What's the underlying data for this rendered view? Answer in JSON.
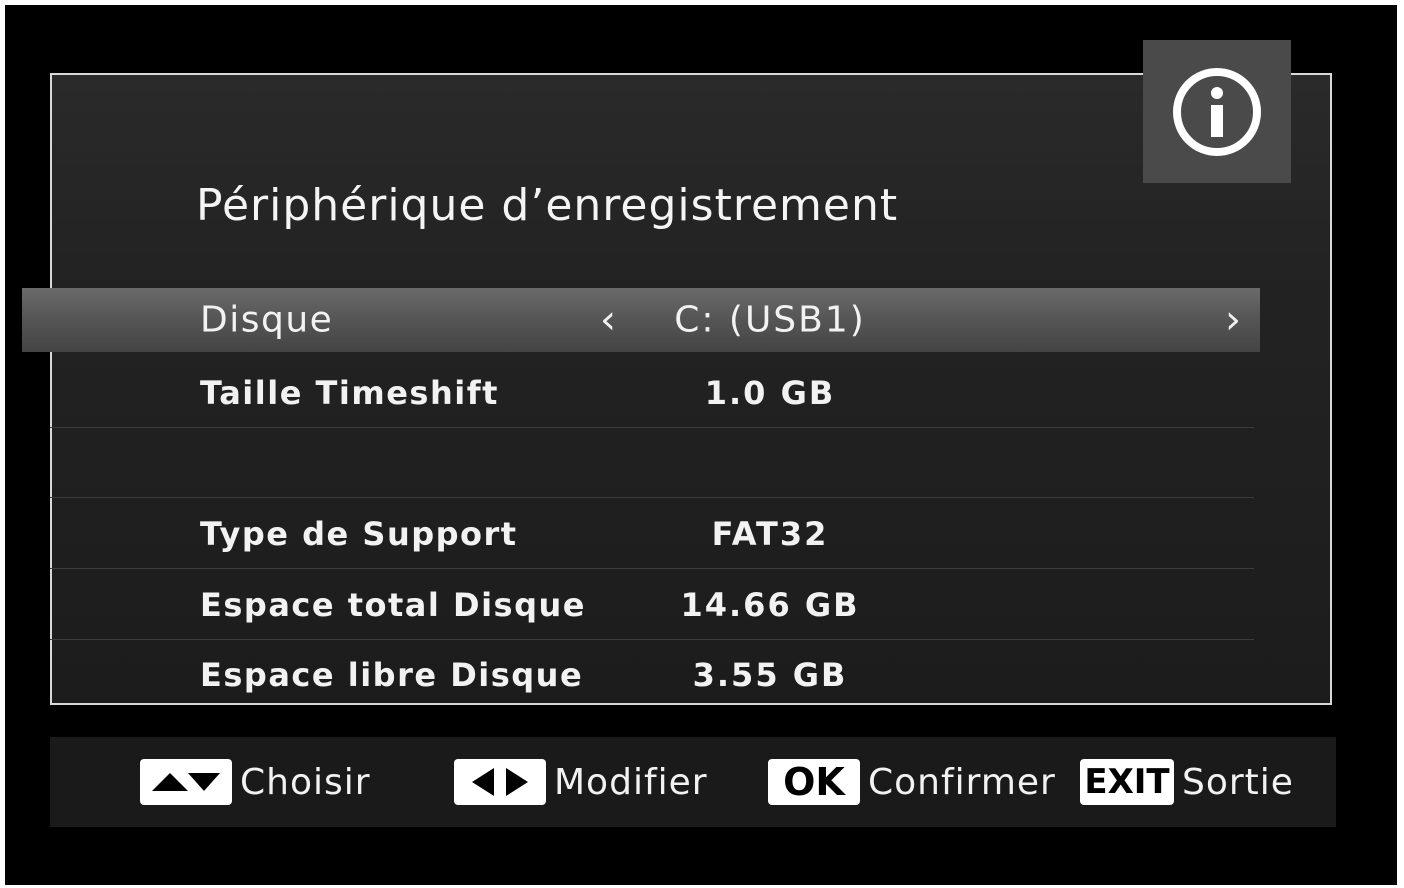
{
  "page": {
    "title": "Périphérique d’enregistrement",
    "info_icon": "info-circle-icon"
  },
  "settings": {
    "selected": {
      "label": "Disque",
      "value": "C: (USB1)",
      "left_arrow": "‹",
      "right_arrow": "›"
    },
    "rows": [
      {
        "label": "Taille Timeshift",
        "value": "1.0 GB"
      },
      {
        "label": "",
        "value": ""
      },
      {
        "label": "Type de Support",
        "value": "FAT32"
      },
      {
        "label": "Espace total Disque",
        "value": "14.66 GB"
      },
      {
        "label": "Espace libre Disque",
        "value": "3.55 GB"
      }
    ]
  },
  "footer": {
    "choose": {
      "key_icon": "up-down-arrows-icon",
      "label": "Choisir"
    },
    "modify": {
      "key_icon": "left-right-arrows-icon",
      "label": "Modifier"
    },
    "confirm": {
      "key": "OK",
      "label": "Confirmer"
    },
    "exit": {
      "key": "EXIT",
      "label": "Sortie"
    }
  }
}
